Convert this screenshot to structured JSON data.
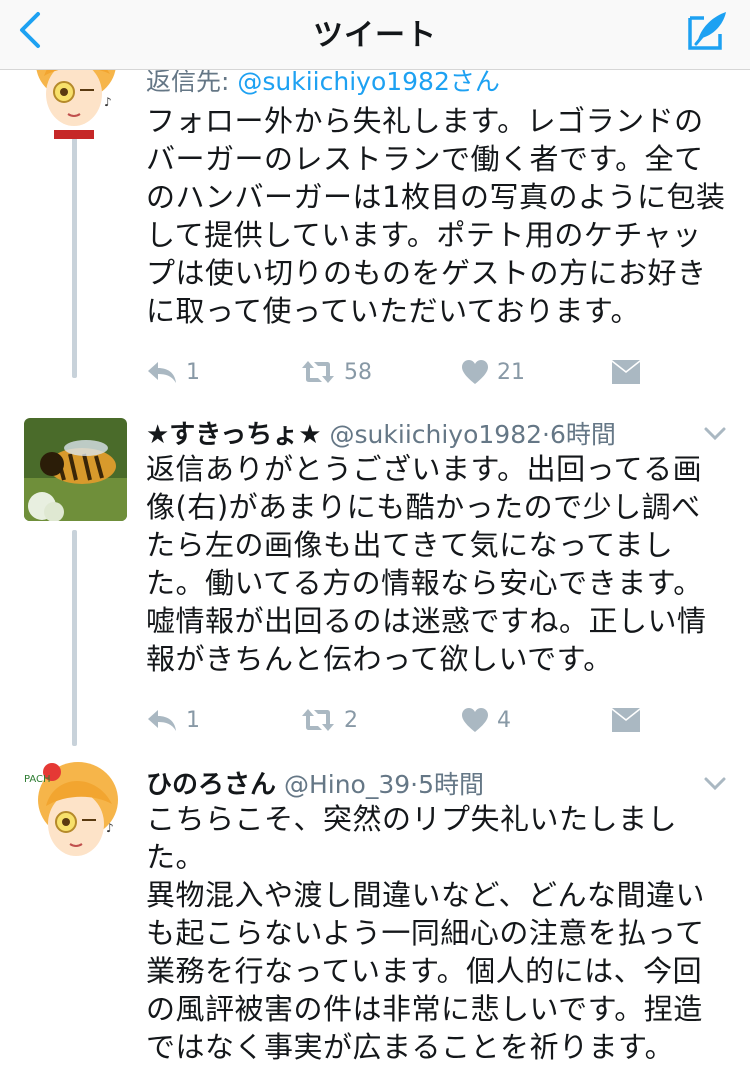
{
  "nav": {
    "title": "ツイート"
  },
  "tweets": [
    {
      "reply_to_prefix": "返信先: ",
      "reply_to_handle": "@sukiichiyo1982さん",
      "lines": [
        "フォロー外から失礼します。レゴランドの",
        "バーガーのレストランで働く者です。全て",
        "のハンバーガーは1枚目の写真のように包装",
        "して提供しています。ポテト用のケチャッ",
        "プは使い切りのものをゲストの方にお好き",
        "に取って使っていただいております。"
      ],
      "reply_count": "1",
      "retweet_count": "58",
      "like_count": "21"
    },
    {
      "name": "★すきっちょ★",
      "handle": "@sukiichiyo1982",
      "time": "6時間",
      "lines": [
        "返信ありがとうございます。出回ってる画",
        "像(右)があまりにも酷かったので少し調べ",
        "たら左の画像も出てきて気になってまし",
        "た。働いてる方の情報なら安心できます。",
        "嘘情報が出回るのは迷惑ですね。正しい情",
        "報がきちんと伝わって欲しいです。"
      ],
      "reply_count": "1",
      "retweet_count": "2",
      "like_count": "4"
    },
    {
      "name": "ひのろさん",
      "handle": "@Hino_39",
      "time": "5時間",
      "lines": [
        "こちらこそ、突然のリプ失礼いたしまし",
        "た。",
        "異物混入や渡し間違いなど、どんな間違い",
        "も起こらないよう一同細心の注意を払って",
        "業務を行なっています。個人的には、今回",
        "の風評被害の件は非常に悲しいです。捏造",
        "ではなく事実が広まることを祈ります。"
      ]
    }
  ],
  "colors": {
    "accent": "#1da1f2",
    "action_gray": "#aab8c2",
    "secondary_text": "#657786",
    "thread_line": "#c8d2da"
  }
}
